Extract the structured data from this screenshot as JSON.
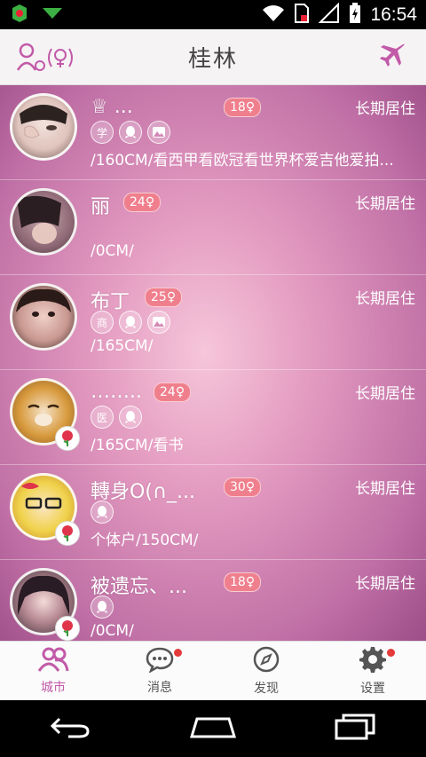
{
  "status_bar": {
    "time": "16:54",
    "icons": [
      "app-notification-icon",
      "download-icon",
      "wifi-icon",
      "sim-card-icon",
      "signal-icon",
      "battery-icon"
    ]
  },
  "header": {
    "title": "桂林",
    "left_icon": "gender-filter-icon",
    "right_icon": "airplane-icon"
  },
  "users": [
    {
      "name": "♕   ...",
      "age": "18♀",
      "residence": "长期居住",
      "badges": [
        "学",
        "qq",
        "photo"
      ],
      "info": "/160CM/看西甲看欧冠看世界杯爱吉他爱拍...",
      "has_rose": false,
      "avatar_color": "#e9d6d2"
    },
    {
      "name": "丽",
      "age": "24♀",
      "residence": "长期居住",
      "badges": [],
      "info": "/0CM/",
      "has_rose": false,
      "avatar_color": "#8f6a76"
    },
    {
      "name": "布丁",
      "age": "25♀",
      "residence": "长期居住",
      "badges": [
        "商",
        "qq",
        "photo"
      ],
      "info": "/165CM/",
      "has_rose": false,
      "avatar_color": "#6e4a45"
    },
    {
      "name": "……..",
      "age": "24♀",
      "residence": "长期居住",
      "badges": [
        "医",
        "qq"
      ],
      "info": "/165CM/看书",
      "has_rose": true,
      "avatar_color": "#d89a3d"
    },
    {
      "name": "轉身O(∩_...",
      "age": "30♀",
      "residence": "长期居住",
      "badges": [
        "qq"
      ],
      "info": "个体户/150CM/",
      "has_rose": true,
      "avatar_color": "#f0d24b"
    },
    {
      "name": "被遗忘、...",
      "age": "18♀",
      "residence": "长期居住",
      "badges": [
        "qq"
      ],
      "info": "/0CM/",
      "has_rose": true,
      "avatar_color": "#3a2d36"
    }
  ],
  "bottom_nav": [
    {
      "label": "城市",
      "icon": "people-icon",
      "active": true,
      "dot": false
    },
    {
      "label": "消息",
      "icon": "chat-icon",
      "active": false,
      "dot": true
    },
    {
      "label": "发现",
      "icon": "compass-icon",
      "active": false,
      "dot": false
    },
    {
      "label": "设置",
      "icon": "gear-icon",
      "active": false,
      "dot": true
    }
  ],
  "system_nav": [
    "back-icon",
    "home-icon",
    "recents-icon"
  ],
  "colors": {
    "accent": "#c25aa8",
    "age_badge": "#f07f8d",
    "notification_dot": "#e53a3a"
  }
}
